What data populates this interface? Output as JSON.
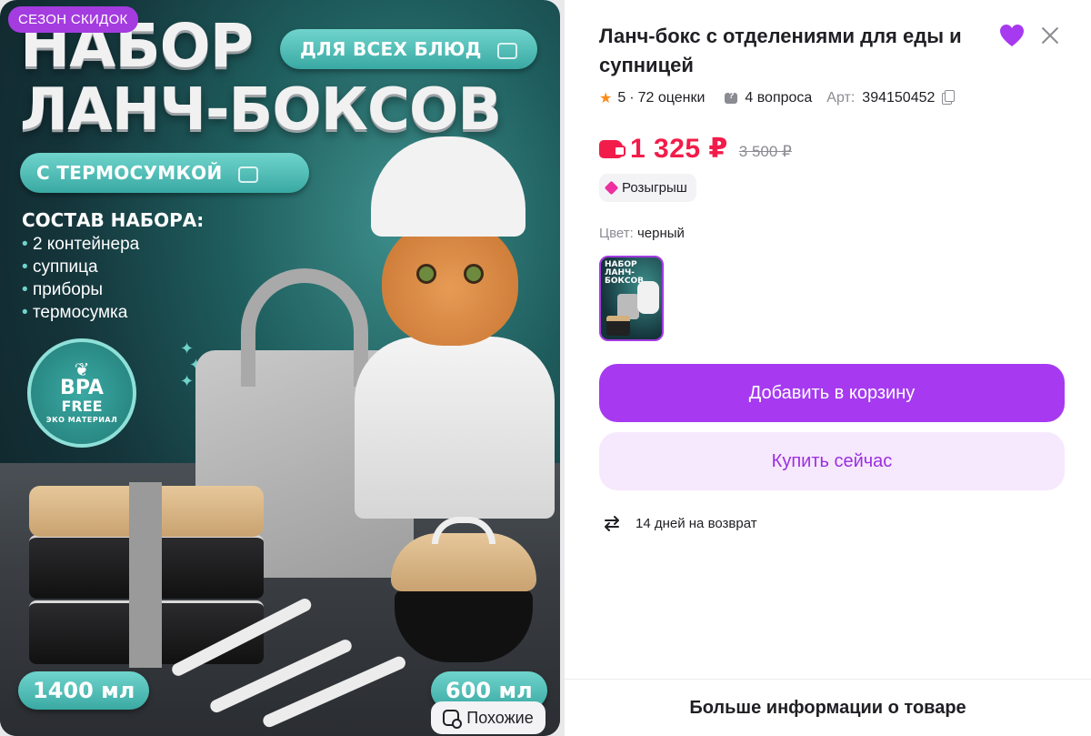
{
  "image": {
    "sale_badge": "СЕЗОН СКИДОК",
    "title_line1": "НАБОР",
    "title_line2": "ЛАНЧ-БОКСОВ",
    "pill_all_dishes": "ДЛЯ ВСЕХ БЛЮД",
    "pill_thermo": "С ТЕРМОСУМКОЙ",
    "set_title": "СОСТАВ НАБОРА:",
    "set_items": [
      "2 контейнера",
      "суппица",
      "приборы",
      "термосумка"
    ],
    "bpa_line1": "BPA",
    "bpa_line2": "FREE",
    "bpa_line3": "ЭКО МАТЕРИАЛ",
    "size_left": "1400 мл",
    "size_right": "600 мл",
    "similar_label": "Похожие"
  },
  "product": {
    "title": "Ланч-бокс с отделениями для еды и супницей",
    "rating": "5",
    "reviews": "72 оценки",
    "questions": "4 вопроса",
    "article_label": "Арт:",
    "article": "394150452",
    "price_current": "1 325 ₽",
    "price_old": "3 500 ₽",
    "raffle": "Розыгрыш",
    "color_label": "Цвет:",
    "color_value": "черный",
    "add_to_cart": "Добавить в корзину",
    "buy_now": "Купить сейчас",
    "return_policy": "14 дней на возврат",
    "more_info": "Больше информации о товаре"
  },
  "colors": {
    "accent": "#a73af0",
    "price": "#f21c4a",
    "favorite": "#a73af0",
    "star": "#ff8c1a",
    "raffle": "#ee2fa0"
  },
  "icons": {
    "favorite": "heart-icon",
    "close": "close-icon",
    "star": "star-icon",
    "questions": "question-bubble-icon",
    "copy": "copy-icon",
    "price": "wallet-icon",
    "raffle": "raffle-diamond-icon",
    "return": "return-arrows-icon",
    "similar": "similar-search-icon"
  }
}
